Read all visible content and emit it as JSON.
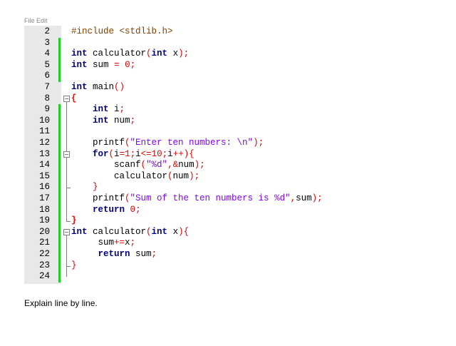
{
  "top_cut_label": "File Edit",
  "editor": {
    "lines": [
      {
        "num": "2",
        "segments": [
          {
            "t": "#include <stdlib.h>",
            "c": "pre"
          }
        ]
      },
      {
        "num": "3",
        "segments": []
      },
      {
        "num": "4",
        "segments": [
          {
            "t": "int",
            "c": "kw"
          },
          {
            "t": " calculator",
            "c": "fn"
          },
          {
            "t": "(",
            "c": "op"
          },
          {
            "t": "int",
            "c": "kw"
          },
          {
            "t": " x",
            "c": "fn"
          },
          {
            "t": ");",
            "c": "op"
          }
        ]
      },
      {
        "num": "5",
        "segments": [
          {
            "t": "int",
            "c": "kw"
          },
          {
            "t": " sum ",
            "c": "fn"
          },
          {
            "t": "=",
            "c": "op"
          },
          {
            "t": " ",
            "c": "fn"
          },
          {
            "t": "0",
            "c": "num"
          },
          {
            "t": ";",
            "c": "op"
          }
        ]
      },
      {
        "num": "6",
        "segments": []
      },
      {
        "num": "7",
        "segments": [
          {
            "t": "int",
            "c": "kw"
          },
          {
            "t": " main",
            "c": "fn"
          },
          {
            "t": "()",
            "c": "op"
          }
        ]
      },
      {
        "num": "8",
        "segments": [
          {
            "t": "{",
            "c": "brace-hl"
          }
        ]
      },
      {
        "num": "9",
        "segments": [
          {
            "t": "    ",
            "c": "fn"
          },
          {
            "t": "int",
            "c": "kw"
          },
          {
            "t": " i",
            "c": "fn"
          },
          {
            "t": ";",
            "c": "op"
          }
        ]
      },
      {
        "num": "10",
        "segments": [
          {
            "t": "    ",
            "c": "fn"
          },
          {
            "t": "int",
            "c": "kw"
          },
          {
            "t": " num",
            "c": "fn"
          },
          {
            "t": ";",
            "c": "op"
          }
        ]
      },
      {
        "num": "11",
        "segments": []
      },
      {
        "num": "12",
        "segments": [
          {
            "t": "    printf",
            "c": "fn"
          },
          {
            "t": "(",
            "c": "op"
          },
          {
            "t": "\"Enter ten numbers: \\n\"",
            "c": "str"
          },
          {
            "t": ");",
            "c": "op"
          }
        ]
      },
      {
        "num": "13",
        "segments": [
          {
            "t": "    ",
            "c": "fn"
          },
          {
            "t": "for",
            "c": "kw"
          },
          {
            "t": "(",
            "c": "op"
          },
          {
            "t": "i",
            "c": "fn"
          },
          {
            "t": "=",
            "c": "op"
          },
          {
            "t": "1",
            "c": "num"
          },
          {
            "t": ";",
            "c": "op"
          },
          {
            "t": "i",
            "c": "fn"
          },
          {
            "t": "<=",
            "c": "op"
          },
          {
            "t": "10",
            "c": "num"
          },
          {
            "t": ";",
            "c": "op"
          },
          {
            "t": "i",
            "c": "fn"
          },
          {
            "t": "++){",
            "c": "op"
          }
        ]
      },
      {
        "num": "14",
        "segments": [
          {
            "t": "        scanf",
            "c": "fn"
          },
          {
            "t": "(",
            "c": "op"
          },
          {
            "t": "\"%d\"",
            "c": "str"
          },
          {
            "t": ",&",
            "c": "op"
          },
          {
            "t": "num",
            "c": "fn"
          },
          {
            "t": ");",
            "c": "op"
          }
        ]
      },
      {
        "num": "15",
        "segments": [
          {
            "t": "        calculator",
            "c": "fn"
          },
          {
            "t": "(",
            "c": "op"
          },
          {
            "t": "num",
            "c": "fn"
          },
          {
            "t": ");",
            "c": "op"
          }
        ]
      },
      {
        "num": "16",
        "segments": [
          {
            "t": "    ",
            "c": "fn"
          },
          {
            "t": "}",
            "c": "op"
          }
        ]
      },
      {
        "num": "17",
        "segments": [
          {
            "t": "    printf",
            "c": "fn"
          },
          {
            "t": "(",
            "c": "op"
          },
          {
            "t": "\"Sum of the ten numbers is %d\"",
            "c": "str"
          },
          {
            "t": ",",
            "c": "op"
          },
          {
            "t": "sum",
            "c": "fn"
          },
          {
            "t": ");",
            "c": "op"
          }
        ]
      },
      {
        "num": "18",
        "segments": [
          {
            "t": "    ",
            "c": "fn"
          },
          {
            "t": "return",
            "c": "kw"
          },
          {
            "t": " ",
            "c": "fn"
          },
          {
            "t": "0",
            "c": "num"
          },
          {
            "t": ";",
            "c": "op"
          }
        ]
      },
      {
        "num": "19",
        "segments": [
          {
            "t": "}",
            "c": "brace-hl"
          }
        ]
      },
      {
        "num": "20",
        "segments": [
          {
            "t": "int",
            "c": "kw"
          },
          {
            "t": " calculator",
            "c": "fn"
          },
          {
            "t": "(",
            "c": "op"
          },
          {
            "t": "int",
            "c": "kw"
          },
          {
            "t": " x",
            "c": "fn"
          },
          {
            "t": "){",
            "c": "op"
          }
        ]
      },
      {
        "num": "21",
        "segments": [
          {
            "t": "     sum",
            "c": "fn"
          },
          {
            "t": "+=",
            "c": "op"
          },
          {
            "t": "x",
            "c": "fn"
          },
          {
            "t": ";",
            "c": "op"
          }
        ]
      },
      {
        "num": "22",
        "segments": [
          {
            "t": "     ",
            "c": "fn"
          },
          {
            "t": "return",
            "c": "kw"
          },
          {
            "t": " sum",
            "c": "fn"
          },
          {
            "t": ";",
            "c": "op"
          }
        ]
      },
      {
        "num": "23",
        "segments": [
          {
            "t": "}",
            "c": "op"
          }
        ]
      },
      {
        "num": "24",
        "segments": []
      }
    ]
  },
  "question": "Explain line by line."
}
